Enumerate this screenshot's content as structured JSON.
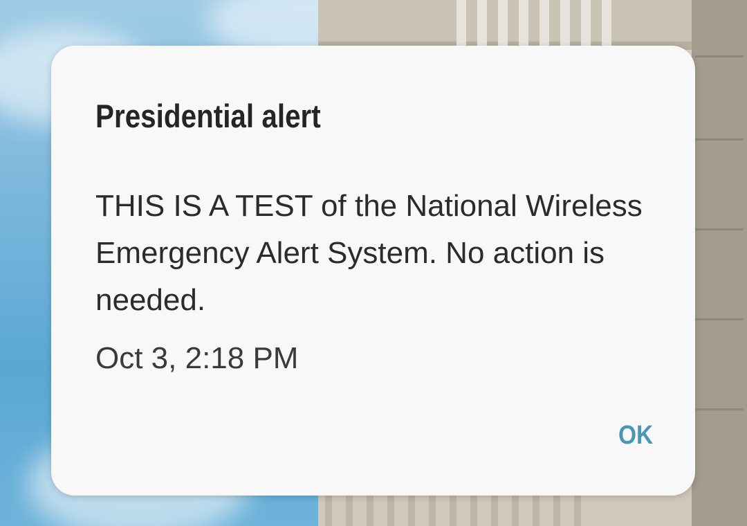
{
  "dialog": {
    "title": "Presidential alert",
    "message": "THIS IS A TEST of the National Wireless Emergency Alert System. No action is needed.",
    "timestamp": "Oct 3, 2:18 PM",
    "ok_label": "OK"
  },
  "colors": {
    "accent": "#4a97b5",
    "dialog_background": "#f8f8f9",
    "text_primary": "#252525"
  }
}
